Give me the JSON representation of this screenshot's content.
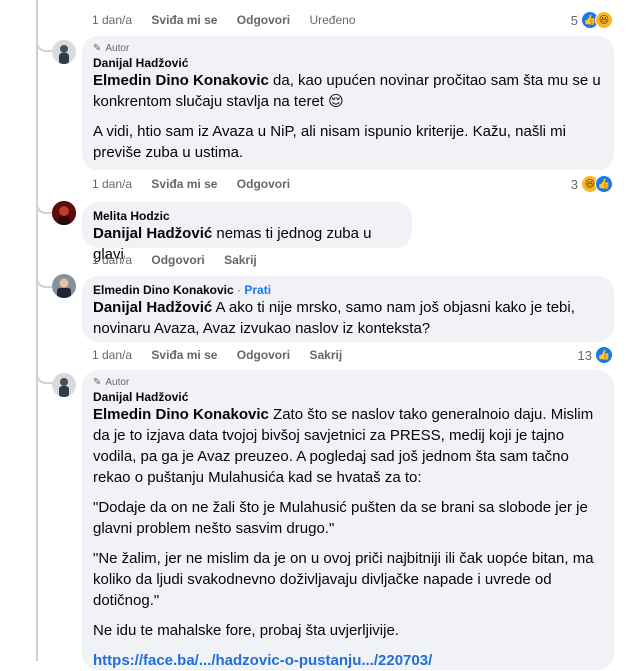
{
  "thread": {
    "top_actions": {
      "time": "1 dan/a",
      "like": "Sviđa mi se",
      "reply": "Odgovori",
      "edited": "Uređeno",
      "reaction_count": "5"
    },
    "comments": [
      {
        "badge": "Autor",
        "author": "Danijal Hadžović",
        "mention": "Elmedin Dino Konakovic",
        "text": " da, kao upućen novinar pročitao sam šta mu se u konkrentom slučaju stavlja na teret",
        "emoji": "😌",
        "para2": "A vidi, htio sam iz Avaza u NiP, ali nisam ispunio kriterije. Kažu, našli mi previše zuba u ustima.",
        "actions": {
          "time": "1 dan/a",
          "like": "Sviđa mi se",
          "reply": "Odgovori",
          "reaction_count": "3"
        }
      },
      {
        "author": "Melita Hodzic",
        "mention": "Danijal Hadžović",
        "text": " nemas ti jednog zuba u glavi",
        "actions": {
          "time": "1 dan/a",
          "reply": "Odgovori",
          "hide": "Sakrij"
        }
      },
      {
        "author": "Elmedin Dino Konakovic",
        "sep": " · ",
        "follow": "Prati",
        "mention": "Danijal Hadžović",
        "text": " A ako ti nije mrsko, samo nam još objasni kako je tebi, novinaru Avaza, Avaz izvukao naslov iz konteksta?",
        "actions": {
          "time": "1 dan/a",
          "like": "Sviđa mi se",
          "reply": "Odgovori",
          "hide": "Sakrij",
          "reaction_count": "13"
        }
      },
      {
        "badge": "Autor",
        "author": "Danijal Hadžović",
        "mention": "Elmedin Dino Konakovic",
        "text": " Zato što se naslov tako generalnoio daju. Mislim da je to izjava data tvojoj bivšoj savjetnici za PRESS, medij koji je tajno vodila, pa ga je Avaz preuzeo. A pogledaj sad još jednom šta sam tačno rekao o puštanju Mulahusića kad se hvataš za to:",
        "quote1": "\"Dodaje da on ne žali što je Mulahusić pušten da se brani sa slobode jer je glavni problem nešto sasvim drugo.\"",
        "quote2": "\"Ne žalim, jer ne mislim da je on u ovoj priči najbitniji ili čak uopće bitan, ma koliko da ljudi svakodnevno doživljavaju divljačke napade i uvrede od dotičnog.\"",
        "para4": "Ne idu te mahalske fore, probaj šta uvjerljivije.",
        "link": "https://face.ba/.../hadzovic-o-pustanju.../220703/"
      }
    ]
  },
  "icons": {
    "badge": "pencil-icon",
    "like": "like-reaction-icon",
    "haha": "haha-reaction-icon"
  },
  "colors": {
    "bubble": "#f0f2f5",
    "link": "#216fdb",
    "like": "#1877f2",
    "meta": "#65676b"
  }
}
